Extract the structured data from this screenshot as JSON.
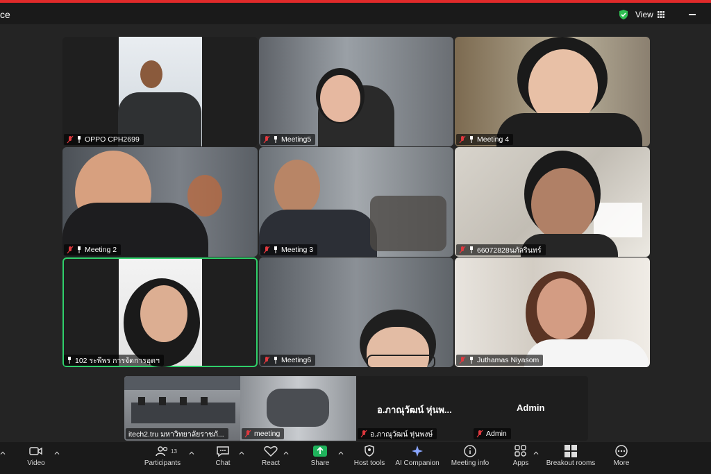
{
  "window": {
    "title_fragment": "ce",
    "view_label": "View"
  },
  "tiles": [
    {
      "name": "OPPO CPH2699",
      "muted": true
    },
    {
      "name": "Meeting5",
      "muted": true
    },
    {
      "name": "Meeting 4",
      "muted": true
    },
    {
      "name": "Meeting 2",
      "muted": true
    },
    {
      "name": "Meeting 3",
      "muted": true
    },
    {
      "name": "66072828นภัสรินทร์",
      "muted": true
    },
    {
      "name": "102 ระพีพร การจัดการอุตฯ",
      "muted": false
    },
    {
      "name": "Meeting6",
      "muted": true
    },
    {
      "name": "Juthamas Niyasom",
      "muted": true
    }
  ],
  "strip": [
    {
      "name": "itech2.tru มหาวิทยาลัยราชภั...",
      "muted": false
    },
    {
      "name": "meeting",
      "muted": true
    },
    {
      "name": "อ.ภาณุวัฒน์ หุ่นพงษ์",
      "display": "อ.ภาณุวัฒน์ หุ่นพ...",
      "muted": true
    },
    {
      "name": "Admin",
      "display": "Admin",
      "muted": true
    }
  ],
  "toolbar": {
    "video": "Video",
    "participants": "Participants",
    "participants_count": "13",
    "chat": "Chat",
    "react": "React",
    "share": "Share",
    "host_tools": "Host tools",
    "ai_companion": "AI Companion",
    "meeting_info": "Meeting info",
    "apps": "Apps",
    "breakout_rooms": "Breakout rooms",
    "more": "More"
  },
  "colors": {
    "active_speaker": "#2fd06a",
    "share": "#1fb35c",
    "muted": "#e0383e",
    "shield": "#2fbf52"
  }
}
